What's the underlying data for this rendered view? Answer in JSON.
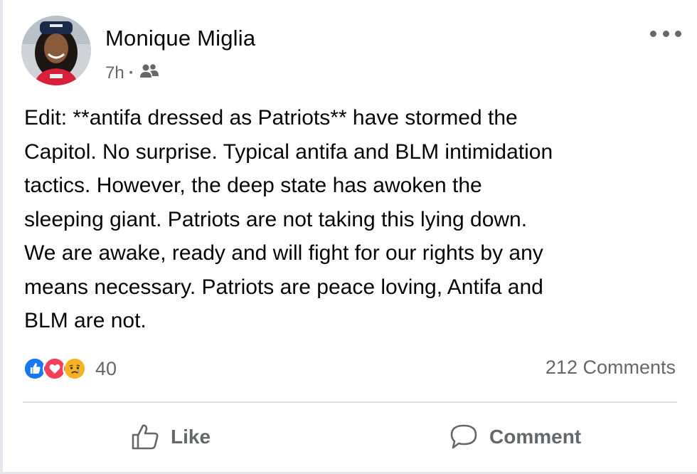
{
  "post": {
    "author": "Monique Miglia",
    "time": "7h",
    "separator": "·",
    "audience_icon": "friends-icon",
    "text": "Edit: **antifa dressed as Patriots** have stormed the\nCapitol. No surprise. Typical antifa and BLM intimidation\ntactics. However, the deep state has awoken the\nsleeping giant. Patriots are not taking this lying down.\nWe are awake, ready and will fight for our rights by any\nmeans necessary. Patriots are peace loving, Antifa and\nBLM are not."
  },
  "reactions": {
    "icons": [
      "like-reaction-icon",
      "love-reaction-icon",
      "sad-reaction-icon"
    ],
    "count": "40"
  },
  "comments": {
    "count_label": "212 Comments"
  },
  "actions": {
    "like_label": "Like",
    "comment_label": "Comment"
  },
  "colors": {
    "like_blue": "#1877f2",
    "love_red": "#f33e58",
    "sad_yellow": "#f7b125",
    "secondary_text": "#65676b"
  }
}
